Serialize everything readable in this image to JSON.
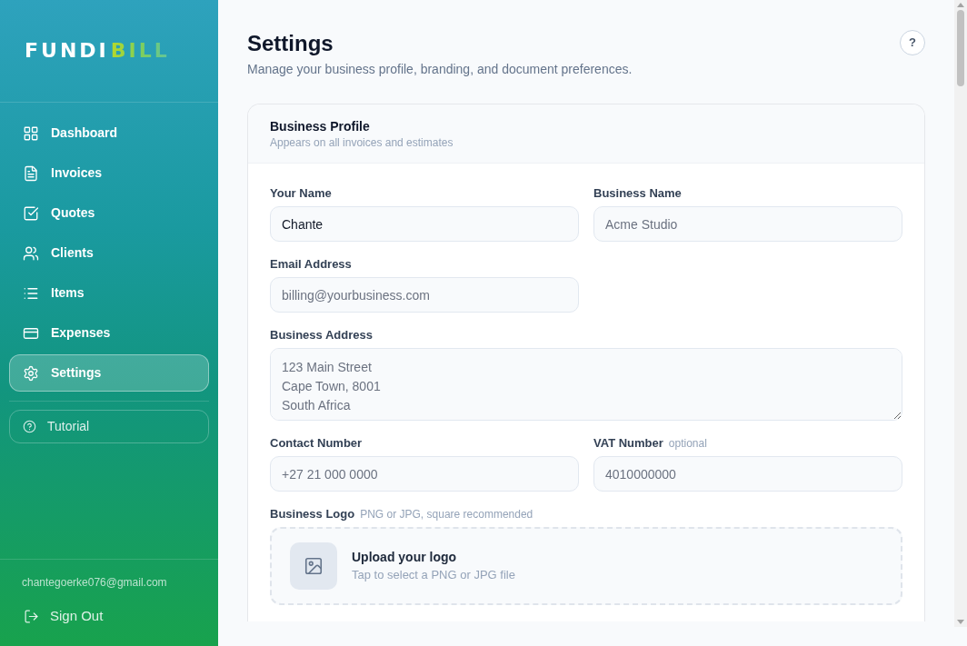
{
  "sidebar": {
    "logo": {
      "text": "FUNDI",
      "accent": "BILL"
    },
    "nav_items": [
      {
        "label": "Dashboard",
        "selected": false
      },
      {
        "label": "Invoices",
        "selected": false
      },
      {
        "label": "Quotes",
        "selected": false
      },
      {
        "label": "Clients",
        "selected": false
      },
      {
        "label": "Items",
        "selected": false
      },
      {
        "label": "Expenses",
        "selected": false
      },
      {
        "label": "Settings",
        "selected": true
      }
    ],
    "tutorial_button": "Tutorial",
    "user_email": "chantegoerke076@gmail.com",
    "sign_out": "Sign Out"
  },
  "header": {
    "title": "Settings",
    "subtitle": "Manage your business profile, branding, and document preferences.",
    "help_button": "?"
  },
  "card": {
    "title": "Business Profile",
    "subtitle": "Appears on all invoices and estimates",
    "fields": [
      {
        "kind": "input",
        "label": "Your Name",
        "value": "Chante"
      },
      {
        "kind": "input",
        "label": "Business Name",
        "placeholder": "Acme Studio"
      },
      {
        "kind": "input",
        "label": "Email Address",
        "placeholder": "billing@yourbusiness.com"
      },
      {
        "kind": "textarea",
        "label": "Business Address",
        "placeholder": "123 Main Street\nCape Town, 8001\nSouth Africa"
      },
      {
        "kind": "input",
        "label": "Contact Number",
        "placeholder": "+27 21 000 0000"
      },
      {
        "kind": "input",
        "label": "VAT Number",
        "note": "optional",
        "placeholder": "4010000000"
      },
      {
        "kind": "upload",
        "label": "Business Logo",
        "note": "PNG or JPG, square recommended",
        "title": "Upload your logo",
        "hint": "Tap to select a PNG or JPG file"
      }
    ]
  }
}
